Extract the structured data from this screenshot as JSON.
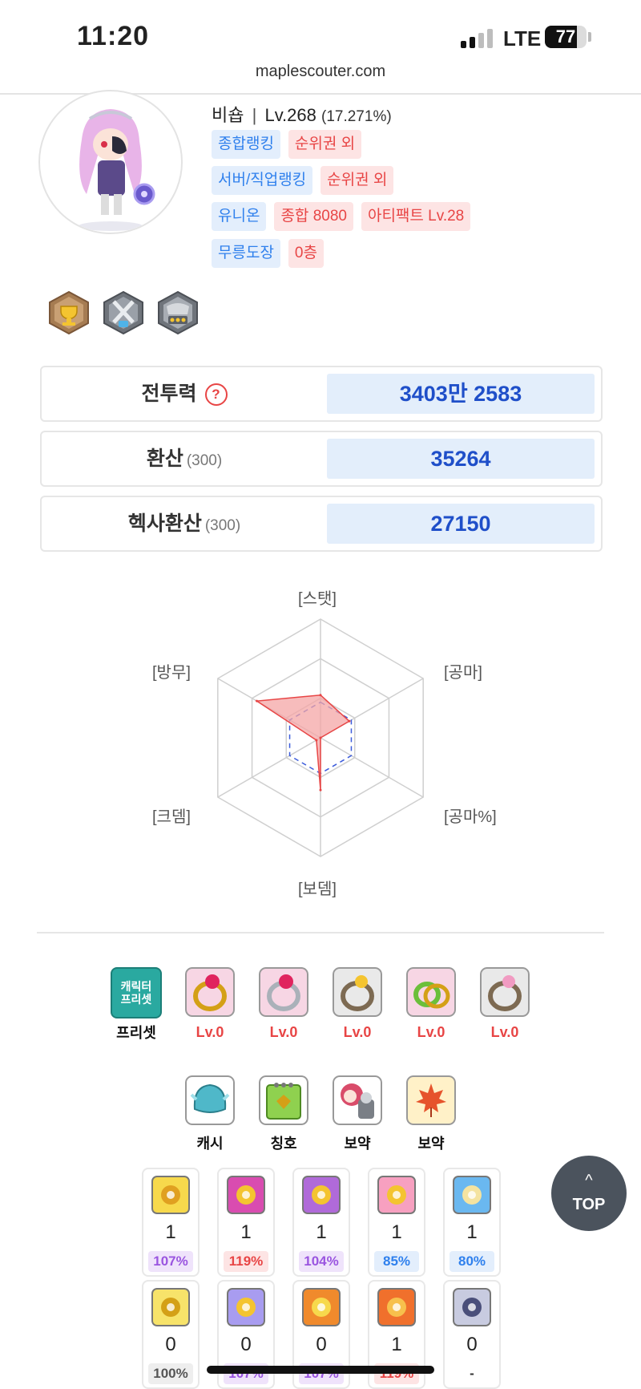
{
  "status_bar": {
    "time": "11:20",
    "network": "LTE",
    "battery": "77",
    "battery_level": 0.77
  },
  "browser": {
    "url": "maplescouter.com"
  },
  "profile": {
    "class_name": "비숍",
    "separator": "|",
    "level": "Lv.268",
    "exp_percent": "(17.271%)",
    "rankings": [
      {
        "label": "종합랭킹",
        "value": "순위권 외"
      },
      {
        "label": "서버/직업랭킹",
        "value": "순위권 외"
      },
      {
        "label": "유니온",
        "value": "종합 8080",
        "extra": "아티팩트 Lv.28"
      },
      {
        "label": "무릉도장",
        "value": "0층"
      }
    ],
    "medals": [
      "trophy-medal-icon",
      "crossed-swords-medal-icon",
      "armor-medal-icon"
    ]
  },
  "stats": [
    {
      "label": "전투력",
      "sub": "",
      "value": "3403만 2583",
      "help": "?"
    },
    {
      "label": "환산",
      "sub": "(300)",
      "value": "35264"
    },
    {
      "label": "헥사환산",
      "sub": "(300)",
      "value": "27150"
    }
  ],
  "radar": {
    "axes": [
      "[스탯]",
      "[공마]",
      "[공마%]",
      "[보뎀]",
      "[크뎀]",
      "[방무]"
    ],
    "values": [
      0.36,
      0.28,
      0.0,
      0.44,
      0.04,
      0.62
    ],
    "reference": [
      0.3,
      0.3,
      0.3,
      0.3,
      0.3,
      0.3
    ],
    "colors": {
      "fill": "#f4a6a6",
      "stroke": "#e84545",
      "reference": "#3b5bdb",
      "grid": "#cfcfcf"
    }
  },
  "equipment": {
    "preset": {
      "icon_text": "캐릭터 프리셋",
      "label": "프리셋"
    },
    "rings": [
      {
        "icon": "gold-ruby-ring-icon",
        "level": "Lv.0"
      },
      {
        "icon": "silver-ruby-ring-icon",
        "level": "Lv.0"
      },
      {
        "icon": "gold-band-ring-icon",
        "level": "Lv.0"
      },
      {
        "icon": "green-twin-ring-icon",
        "level": "Lv.0"
      },
      {
        "icon": "pink-gem-ring-icon",
        "level": "Lv.0"
      }
    ],
    "extras": [
      {
        "icon": "cash-helmet-icon",
        "label": "캐시"
      },
      {
        "icon": "title-book-icon",
        "label": "칭호"
      },
      {
        "icon": "pet-duo-icon",
        "label": "보약"
      },
      {
        "icon": "maple-leaf-icon",
        "label": "보약"
      }
    ]
  },
  "symbols": {
    "row1": [
      {
        "icon": "arcane-symbol-1-icon",
        "count": "1",
        "rate": "107%",
        "tone": "purple"
      },
      {
        "icon": "arcane-symbol-2-icon",
        "count": "1",
        "rate": "119%",
        "tone": "red"
      },
      {
        "icon": "arcane-symbol-3-icon",
        "count": "1",
        "rate": "104%",
        "tone": "purple"
      },
      {
        "icon": "arcane-symbol-4-icon",
        "count": "1",
        "rate": "85%",
        "tone": "blue"
      },
      {
        "icon": "arcane-symbol-5-icon",
        "count": "1",
        "rate": "80%",
        "tone": "blue"
      }
    ],
    "row2": [
      {
        "icon": "authentic-symbol-1-icon",
        "count": "0",
        "rate": "100%",
        "tone": "gray"
      },
      {
        "icon": "authentic-symbol-2-icon",
        "count": "0",
        "rate": "107%",
        "tone": "purple"
      },
      {
        "icon": "authentic-symbol-3-icon",
        "count": "0",
        "rate": "107%",
        "tone": "purple"
      },
      {
        "icon": "authentic-symbol-4-icon",
        "count": "1",
        "rate": "119%",
        "tone": "red"
      },
      {
        "icon": "authentic-symbol-5-icon",
        "count": "0",
        "rate": "-",
        "tone": "plain"
      }
    ]
  },
  "top_button": {
    "arrow": "^",
    "label": "TOP"
  }
}
